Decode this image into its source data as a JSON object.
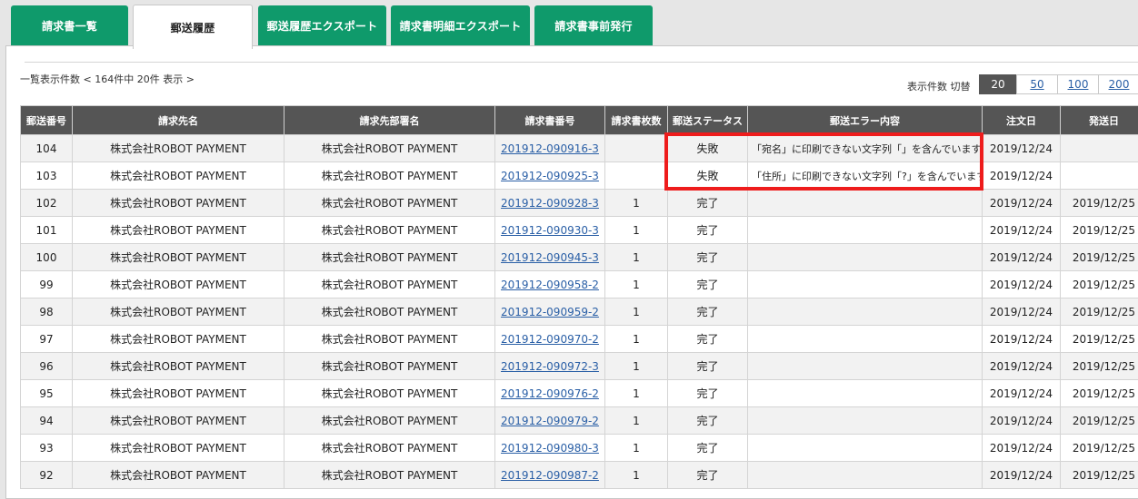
{
  "tabs": [
    {
      "label": "請求書一覧",
      "active": false
    },
    {
      "label": "郵送履歴",
      "active": true
    },
    {
      "label": "郵送履歴エクスポート",
      "active": false
    },
    {
      "label": "請求書明細エクスポート",
      "active": false
    },
    {
      "label": "請求書事前発行",
      "active": false
    }
  ],
  "summary": "一覧表示件数 < 164件中 20件 表示 >",
  "pager": {
    "label": "表示件数 切替",
    "options": [
      "20",
      "50",
      "100",
      "200"
    ],
    "current": "20"
  },
  "table": {
    "headers": [
      "郵送番号",
      "請求先名",
      "請求先部署名",
      "請求書番号",
      "請求書枚数",
      "郵送ステータス",
      "郵送エラー内容",
      "注文日",
      "発送日"
    ],
    "rows": [
      {
        "no": "104",
        "customer": "株式会社ROBOT PAYMENT",
        "dept": "株式会社ROBOT PAYMENT",
        "invoice": "201912-090916-3",
        "count": "",
        "status": "失敗",
        "error": "「宛名」に印刷できない文字列「」を含んでいます。",
        "order_date": "2019/12/24",
        "ship_date": ""
      },
      {
        "no": "103",
        "customer": "株式会社ROBOT PAYMENT",
        "dept": "株式会社ROBOT PAYMENT",
        "invoice": "201912-090925-3",
        "count": "",
        "status": "失敗",
        "error": "「住所」に印刷できない文字列「?」を含んでいます。",
        "order_date": "2019/12/24",
        "ship_date": ""
      },
      {
        "no": "102",
        "customer": "株式会社ROBOT PAYMENT",
        "dept": "株式会社ROBOT PAYMENT",
        "invoice": "201912-090928-3",
        "count": "1",
        "status": "完了",
        "error": "",
        "order_date": "2019/12/24",
        "ship_date": "2019/12/25"
      },
      {
        "no": "101",
        "customer": "株式会社ROBOT PAYMENT",
        "dept": "株式会社ROBOT PAYMENT",
        "invoice": "201912-090930-3",
        "count": "1",
        "status": "完了",
        "error": "",
        "order_date": "2019/12/24",
        "ship_date": "2019/12/25"
      },
      {
        "no": "100",
        "customer": "株式会社ROBOT PAYMENT",
        "dept": "株式会社ROBOT PAYMENT",
        "invoice": "201912-090945-3",
        "count": "1",
        "status": "完了",
        "error": "",
        "order_date": "2019/12/24",
        "ship_date": "2019/12/25"
      },
      {
        "no": "99",
        "customer": "株式会社ROBOT PAYMENT",
        "dept": "株式会社ROBOT PAYMENT",
        "invoice": "201912-090958-2",
        "count": "1",
        "status": "完了",
        "error": "",
        "order_date": "2019/12/24",
        "ship_date": "2019/12/25"
      },
      {
        "no": "98",
        "customer": "株式会社ROBOT PAYMENT",
        "dept": "株式会社ROBOT PAYMENT",
        "invoice": "201912-090959-2",
        "count": "1",
        "status": "完了",
        "error": "",
        "order_date": "2019/12/24",
        "ship_date": "2019/12/25"
      },
      {
        "no": "97",
        "customer": "株式会社ROBOT PAYMENT",
        "dept": "株式会社ROBOT PAYMENT",
        "invoice": "201912-090970-2",
        "count": "1",
        "status": "完了",
        "error": "",
        "order_date": "2019/12/24",
        "ship_date": "2019/12/25"
      },
      {
        "no": "96",
        "customer": "株式会社ROBOT PAYMENT",
        "dept": "株式会社ROBOT PAYMENT",
        "invoice": "201912-090972-3",
        "count": "1",
        "status": "完了",
        "error": "",
        "order_date": "2019/12/24",
        "ship_date": "2019/12/25"
      },
      {
        "no": "95",
        "customer": "株式会社ROBOT PAYMENT",
        "dept": "株式会社ROBOT PAYMENT",
        "invoice": "201912-090976-2",
        "count": "1",
        "status": "完了",
        "error": "",
        "order_date": "2019/12/24",
        "ship_date": "2019/12/25"
      },
      {
        "no": "94",
        "customer": "株式会社ROBOT PAYMENT",
        "dept": "株式会社ROBOT PAYMENT",
        "invoice": "201912-090979-2",
        "count": "1",
        "status": "完了",
        "error": "",
        "order_date": "2019/12/24",
        "ship_date": "2019/12/25"
      },
      {
        "no": "93",
        "customer": "株式会社ROBOT PAYMENT",
        "dept": "株式会社ROBOT PAYMENT",
        "invoice": "201912-090980-3",
        "count": "1",
        "status": "完了",
        "error": "",
        "order_date": "2019/12/24",
        "ship_date": "2019/12/25"
      },
      {
        "no": "92",
        "customer": "株式会社ROBOT PAYMENT",
        "dept": "株式会社ROBOT PAYMENT",
        "invoice": "201912-090987-2",
        "count": "1",
        "status": "完了",
        "error": "",
        "order_date": "2019/12/24",
        "ship_date": "2019/12/25"
      }
    ]
  },
  "colors": {
    "tab_green": "#0f9a6b",
    "header_bg": "#555555",
    "link": "#2a5fa6",
    "highlight_red": "#ee1c1c"
  }
}
